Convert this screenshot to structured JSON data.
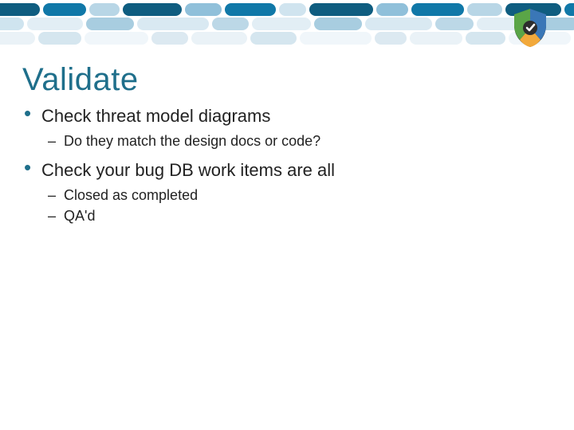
{
  "slide": {
    "title": "Validate",
    "bullets": [
      {
        "text": "Check threat model diagrams",
        "sub": [
          "Do they match the design docs or code?"
        ]
      },
      {
        "text": "Check your bug DB work items are all",
        "sub": [
          "Closed as completed",
          "QA'd"
        ]
      }
    ]
  },
  "colors": {
    "accent": "#1f6f8b"
  }
}
